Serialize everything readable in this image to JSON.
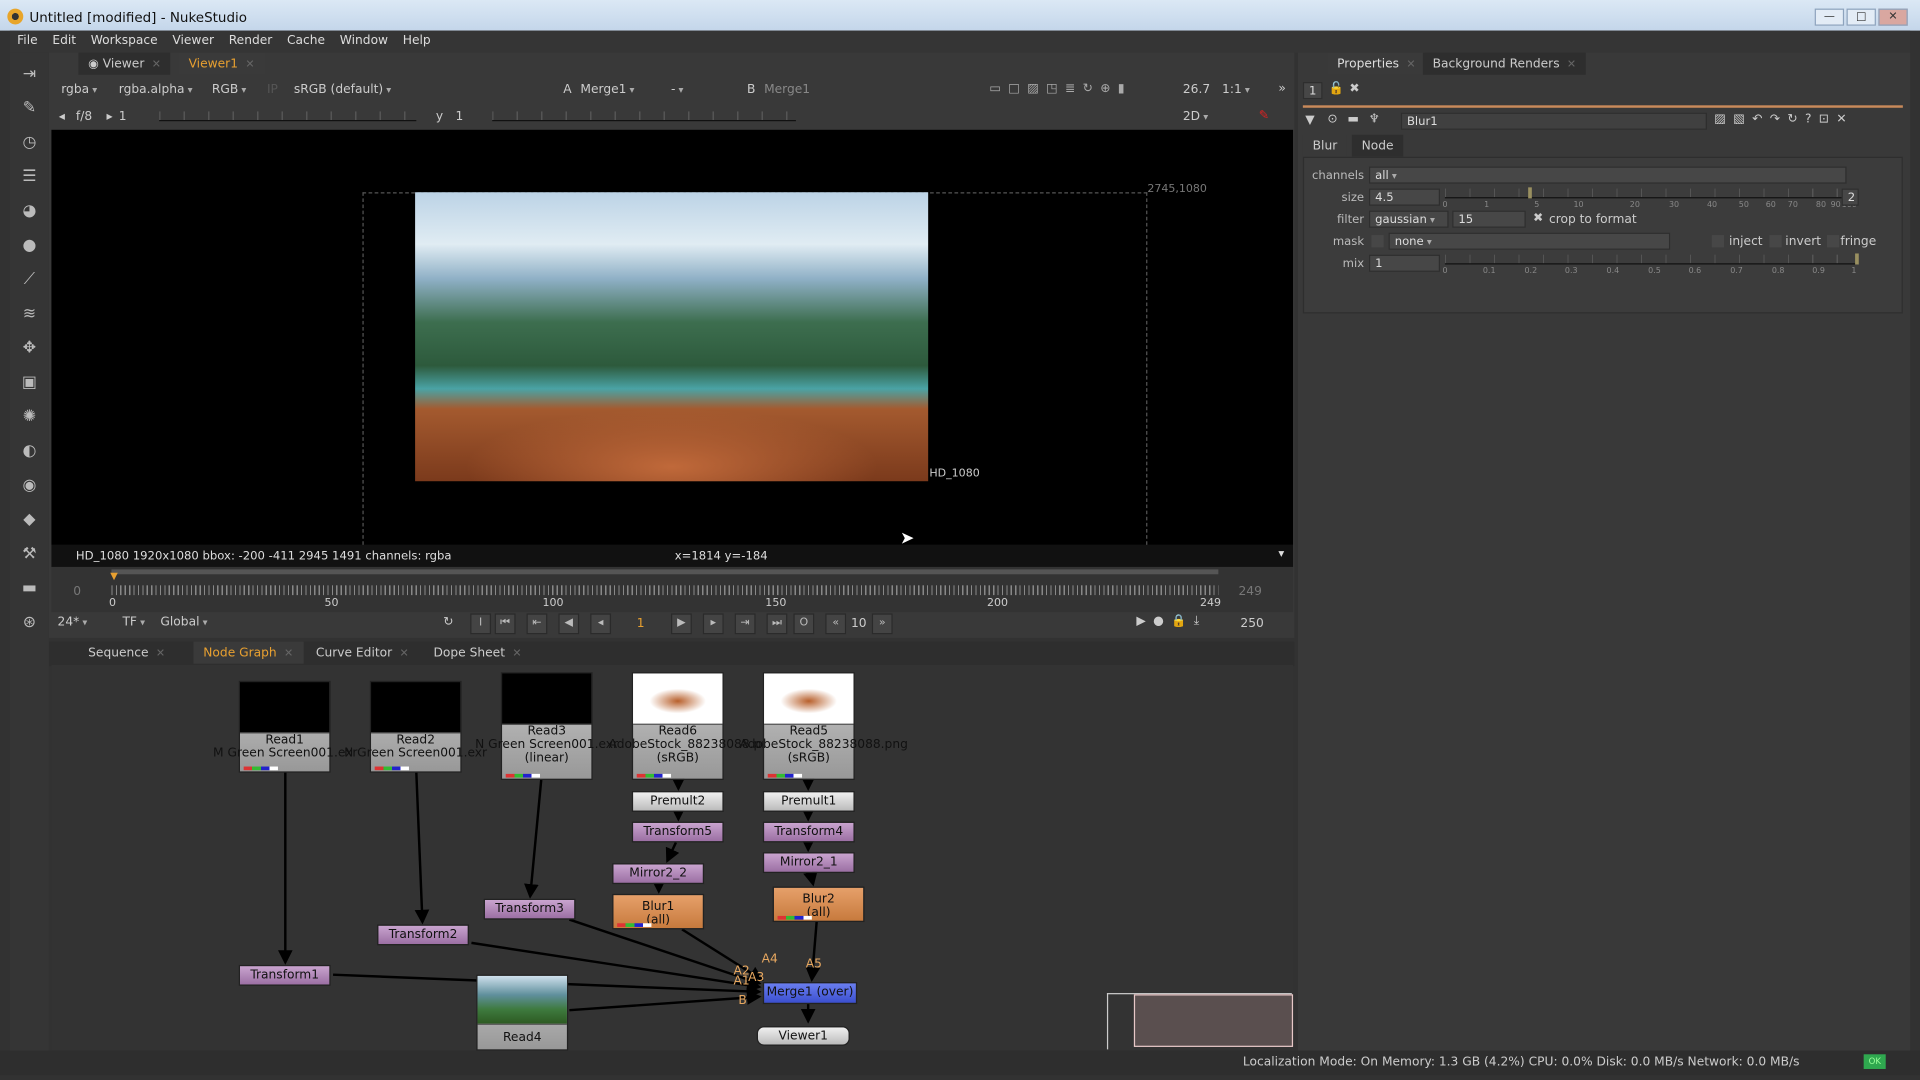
{
  "window": {
    "title": "Untitled [modified] - NukeStudio",
    "controls": [
      "—",
      "□",
      "✕"
    ]
  },
  "menu": [
    "File",
    "Edit",
    "Workspace",
    "Viewer",
    "Render",
    "Cache",
    "Window",
    "Help"
  ],
  "viewer": {
    "tabs": [
      {
        "label": "Viewer"
      },
      {
        "label": "Viewer1",
        "active": true
      }
    ],
    "channels": "rgba",
    "alpha": "rgba.alpha",
    "display": "RGB",
    "ip": "IP",
    "lut": "sRGB (default)",
    "a_label": "A",
    "a_input": "Merge1",
    "b_label": "B",
    "b_input": "Merge1",
    "dash": "-",
    "zoom": "26.7",
    "ratio": "1:1",
    "fstop": "f/8",
    "gain": "1",
    "gamma_label": "y",
    "gamma": "1",
    "mode": "2D",
    "format_label": "HD_1080",
    "bbox_corner": "2745,1080",
    "info": "HD_1080 1920x1080  bbox: -200 -411 2945 1491 channels: rgba",
    "coords": "x=1814 y=-184"
  },
  "timeline": {
    "start": "0",
    "end": "249",
    "current_frame": "1",
    "ticks": [
      "0",
      "50",
      "100",
      "150",
      "200",
      "249"
    ],
    "fps": "24*",
    "tf": "TF",
    "scope": "Global",
    "frame_field": "1",
    "step": "10",
    "last": "250",
    "in_out": [
      "I",
      "O"
    ]
  },
  "bottom_tabs": [
    {
      "label": "Sequence"
    },
    {
      "label": "Node Graph",
      "active": true
    },
    {
      "label": "Curve Editor"
    },
    {
      "label": "Dope Sheet"
    }
  ],
  "nodes": {
    "read1": {
      "name": "Read1",
      "file": "M Green Screen001.exr"
    },
    "read2": {
      "name": "Read2",
      "file": "N Green Screen001.exr"
    },
    "read3": {
      "name": "Read3",
      "file": "N Green Screen001.exr",
      "cs": "(linear)"
    },
    "read6": {
      "name": "Read6",
      "file": "AdobeStock_88238088.png",
      "cs": "(sRGB)"
    },
    "read5": {
      "name": "Read5",
      "file": "AdobeStock_88238088.png",
      "cs": "(sRGB)"
    },
    "read4": {
      "name": "Read4"
    },
    "premult2": "Premult2",
    "premult1": "Premult1",
    "transform5": "Transform5",
    "transform4": "Transform4",
    "mirror2_2": "Mirror2_2",
    "mirror2_1": "Mirror2_1",
    "blur1": {
      "name": "Blur1",
      "sub": "(all)"
    },
    "blur2": {
      "name": "Blur2",
      "sub": "(all)"
    },
    "transform3": "Transform3",
    "transform2": "Transform2",
    "transform1": "Transform1",
    "merge1": "Merge1 (over)",
    "viewer1": "Viewer1",
    "inputs": {
      "a1": "A1",
      "a2": "A2",
      "a3": "A3",
      "a4": "A4",
      "a5": "A5",
      "b": "B"
    }
  },
  "properties": {
    "tabs": [
      {
        "label": "Properties",
        "active": true
      },
      {
        "label": "Background Renders"
      }
    ],
    "max_panels": "1",
    "node_name": "Blur1",
    "node_tabs": [
      "Blur",
      "Node"
    ],
    "channels": {
      "label": "channels",
      "value": "all"
    },
    "size": {
      "label": "size",
      "value": "4.5",
      "ticks": [
        "0",
        "1",
        "5",
        "10",
        "20",
        "30",
        "40",
        "50",
        "60",
        "70",
        "80",
        "90",
        "100"
      ],
      "dims": "2"
    },
    "filter": {
      "label": "filter",
      "value": "gaussian",
      "quality": "15",
      "crop_label": "crop to format",
      "crop": true
    },
    "mask": {
      "label": "mask",
      "value": "none",
      "inject": "inject",
      "invert": "invert",
      "fringe": "fringe"
    },
    "mix": {
      "label": "mix",
      "value": "1",
      "ticks": [
        "0",
        "0.1",
        "0.2",
        "0.3",
        "0.4",
        "0.5",
        "0.6",
        "0.7",
        "0.8",
        "0.9",
        "1"
      ]
    }
  },
  "status": {
    "text": "Localization Mode: On Memory: 1.3 GB (4.2%) CPU: 0.0% Disk: 0.0 MB/s Network: 0.0 MB/s",
    "badge": "OK",
    "badge_color": "#2fa84f"
  },
  "colors": {
    "accent": "#e8a030",
    "properties_line": "#c98a5a"
  }
}
